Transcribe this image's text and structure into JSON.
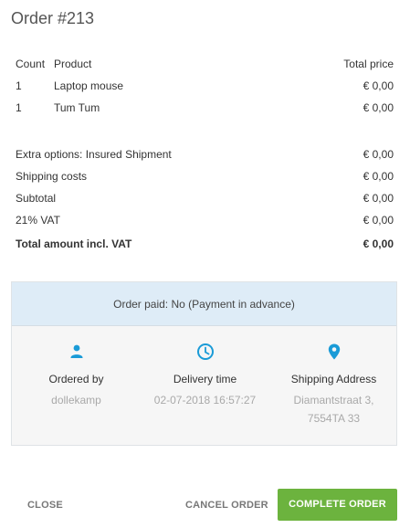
{
  "order": {
    "title": "Order #213"
  },
  "table": {
    "headers": {
      "count": "Count",
      "product": "Product",
      "price": "Total price"
    },
    "items": [
      {
        "count": "1",
        "product": "Laptop mouse",
        "price": "€ 0,00"
      },
      {
        "count": "1",
        "product": "Tum Tum",
        "price": "€ 0,00"
      }
    ]
  },
  "summary": [
    {
      "label": "Extra options: Insured Shipment",
      "value": "€ 0,00"
    },
    {
      "label": "Shipping costs",
      "value": "€ 0,00"
    },
    {
      "label": "Subtotal",
      "value": "€ 0,00"
    },
    {
      "label": "21% VAT",
      "value": "€ 0,00"
    }
  ],
  "total": {
    "label": "Total amount incl. VAT",
    "value": "€ 0,00"
  },
  "payment": {
    "status": "Order paid: No (Payment in advance)"
  },
  "details": {
    "ordered_by": {
      "label": "Ordered by",
      "value": "dollekamp"
    },
    "delivery": {
      "label": "Delivery time",
      "value": "02-07-2018 16:57:27"
    },
    "shipping": {
      "label": "Shipping Address",
      "line1": "Diamantstraat 3,",
      "line2": "7554TA 33"
    }
  },
  "actions": {
    "close": "CLOSE",
    "cancel": "CANCEL ORDER",
    "complete": "COMPLETE ORDER"
  },
  "colors": {
    "accent_icon": "#1a9bd7",
    "complete_button": "#6cb33e",
    "banner_bg": "#deecf7"
  },
  "icons": {
    "ordered_by": "person-icon",
    "delivery": "clock-icon",
    "shipping": "location-pin-icon"
  }
}
